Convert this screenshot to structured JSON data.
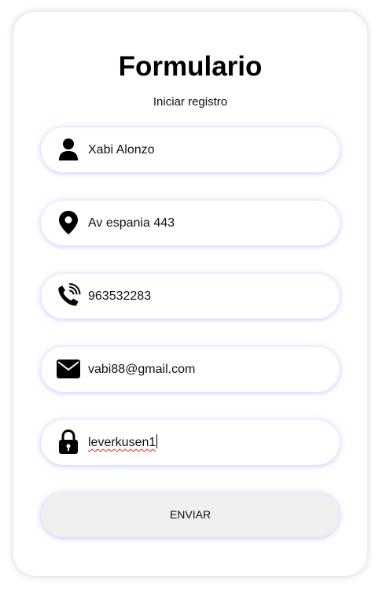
{
  "form": {
    "title": "Formulario",
    "subtitle": "Iniciar registro",
    "fields": [
      {
        "name": "nombre",
        "icon": "user-icon",
        "value": "Xabi Alonzo"
      },
      {
        "name": "direccion",
        "icon": "location-pin-icon",
        "value": "Av espania 443"
      },
      {
        "name": "telefono",
        "icon": "phone-icon",
        "value": "963532283"
      },
      {
        "name": "email",
        "icon": "envelope-icon",
        "value": "vabi88@gmail.com"
      },
      {
        "name": "password",
        "icon": "lock-icon",
        "value": "leverkusen1"
      }
    ],
    "submit_label": "ENVIAR"
  },
  "colors": {
    "background": "#ffffff",
    "field_glow": "#8c96ff",
    "button_bg": "#efefef",
    "text": "#111111",
    "icon": "#000000"
  }
}
